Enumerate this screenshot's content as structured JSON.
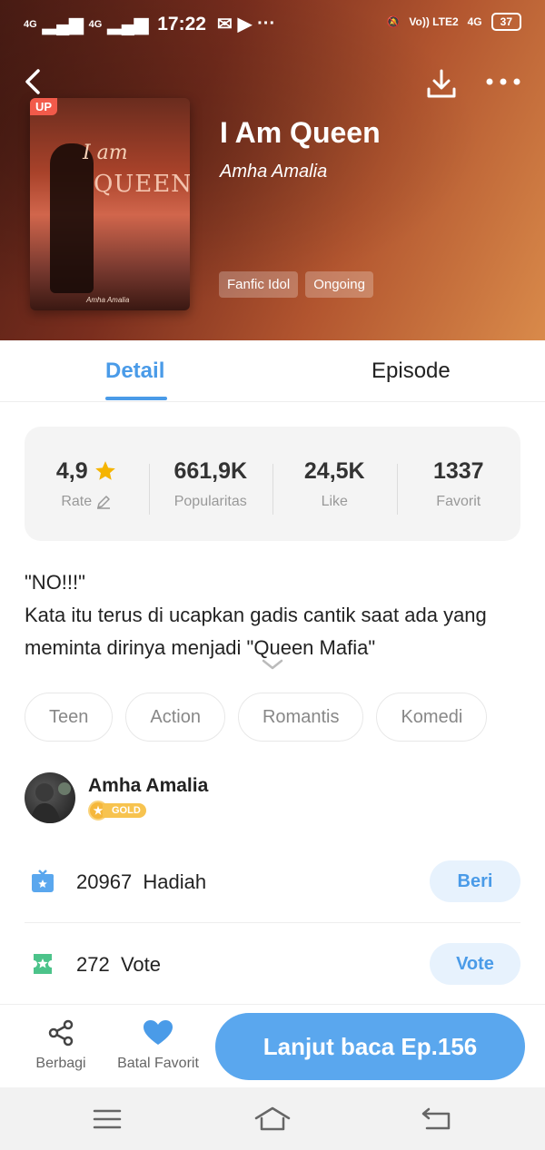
{
  "status_bar": {
    "network1": "4G",
    "network2": "4G",
    "time": "17:22",
    "volte": "Vo)) LTE2",
    "net_right": "4G",
    "battery": "37"
  },
  "book": {
    "badge": "UP",
    "cover_title_line1": "I am",
    "cover_title_line2": "QUEEN",
    "cover_author": "Amha Amalia",
    "title": "I Am Queen",
    "author": "Amha Amalia",
    "tags": [
      "Fanfic Idol",
      "Ongoing"
    ]
  },
  "tabs": {
    "detail": "Detail",
    "episode": "Episode"
  },
  "stats": {
    "rate_value": "4,9",
    "rate_label": "Rate",
    "popularity_value": "661,9K",
    "popularity_label": "Popularitas",
    "like_value": "24,5K",
    "like_label": "Like",
    "favorite_value": "1337",
    "favorite_label": "Favorit"
  },
  "synopsis": {
    "line1": "\"NO!!!\"",
    "line2": "Kata itu terus di ucapkan gadis cantik saat ada yang meminta dirinya menjadi \"Queen Mafia\""
  },
  "genres": [
    "Teen",
    "Action",
    "Romantis",
    "Komedi"
  ],
  "author_row": {
    "name": "Amha Amalia",
    "level": "GOLD"
  },
  "gift": {
    "count": "20967",
    "label": "Hadiah",
    "button": "Beri"
  },
  "vote": {
    "count": "272",
    "label": "Vote",
    "button": "Vote"
  },
  "bottom_bar": {
    "share_label": "Berbagi",
    "favorite_label": "Batal Favorit",
    "read_button": "Lanjut baca Ep.156"
  },
  "colors": {
    "accent": "#4a9be8",
    "read_button": "#5aa7ee",
    "star": "#f5b400",
    "gold": "#f5b73b"
  },
  "icons": {
    "back": "chevron-left-icon",
    "download": "download-icon",
    "more": "more-dots-icon",
    "star": "star-icon",
    "edit": "pencil-icon",
    "expand": "chevron-down-icon",
    "gift": "gift-icon",
    "vote": "ticket-icon",
    "share": "share-icon",
    "favorite": "heart-icon"
  }
}
